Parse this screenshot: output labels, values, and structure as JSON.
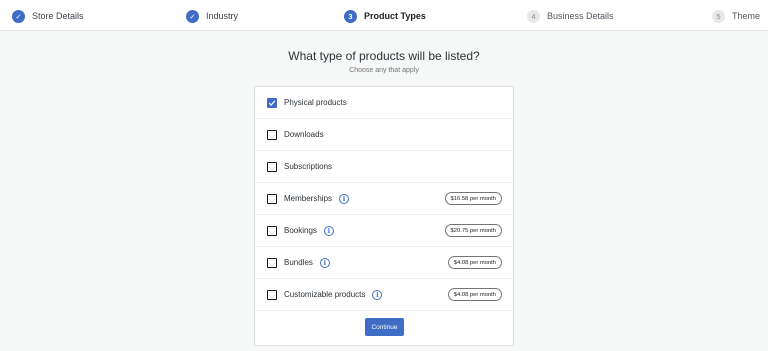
{
  "stepper": {
    "steps": [
      {
        "label": "Store Details",
        "status": "done",
        "marker": "✓"
      },
      {
        "label": "Industry",
        "status": "done",
        "marker": "✓"
      },
      {
        "label": "Product Types",
        "status": "active",
        "marker": "3"
      },
      {
        "label": "Business Details",
        "status": "todo",
        "marker": "4"
      },
      {
        "label": "Theme",
        "status": "todo",
        "marker": "5"
      }
    ]
  },
  "heading": {
    "title": "What type of products will be listed?",
    "subtitle": "Choose any that apply"
  },
  "options": [
    {
      "label": "Physical products",
      "checked": true,
      "info": false,
      "price": ""
    },
    {
      "label": "Downloads",
      "checked": false,
      "info": false,
      "price": ""
    },
    {
      "label": "Subscriptions",
      "checked": false,
      "info": false,
      "price": ""
    },
    {
      "label": "Memberships",
      "checked": false,
      "info": true,
      "price": "$16.58 per month"
    },
    {
      "label": "Bookings",
      "checked": false,
      "info": true,
      "price": "$20.75 per month"
    },
    {
      "label": "Bundles",
      "checked": false,
      "info": true,
      "price": "$4.08 per month"
    },
    {
      "label": "Customizable products",
      "checked": false,
      "info": true,
      "price": "$4.08 per month"
    }
  ],
  "continue_label": "Continue",
  "colors": {
    "accent": "#3f6cc4"
  }
}
